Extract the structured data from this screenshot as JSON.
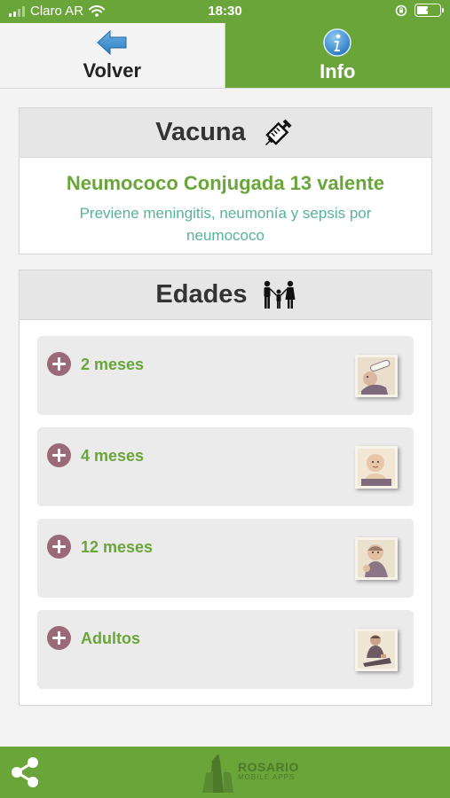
{
  "status_bar": {
    "carrier": "Claro AR",
    "time": "18:30"
  },
  "tabs": {
    "back_label": "Volver",
    "info_label": "Info"
  },
  "vaccine": {
    "header": "Vacuna",
    "name": "Neumococo Conjugada 13 valente",
    "description": "Previene meningitis, neumonía y sepsis por neumococo"
  },
  "ages": {
    "header": "Edades",
    "items": [
      {
        "label": "2 meses",
        "thumb_icon": "baby-bottle-photo"
      },
      {
        "label": "4 meses",
        "thumb_icon": "baby-photo"
      },
      {
        "label": "12 meses",
        "thumb_icon": "toddler-photo"
      },
      {
        "label": "Adultos",
        "thumb_icon": "adult-photo"
      }
    ]
  },
  "footer": {
    "logo_line1": "ROSARIO",
    "logo_line2": "MOBILE APPS"
  },
  "colors": {
    "brand_green": "#6aa53a",
    "teal_text": "#58b29a",
    "plus_icon": "#9b6a79"
  }
}
